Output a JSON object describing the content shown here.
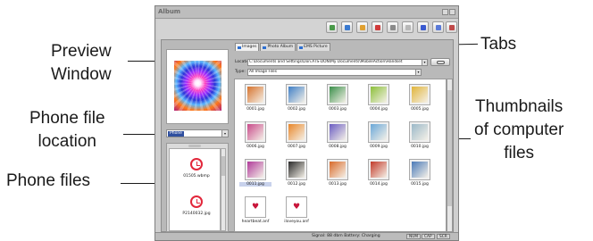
{
  "window": {
    "title": "Album"
  },
  "toolbar": {
    "icons": [
      "import-icon",
      "export-icon",
      "edit-icon",
      "delete-icon",
      "slideshow-icon",
      "rotate-left-icon",
      "rotate-right-icon",
      "info-icon",
      "print-icon"
    ]
  },
  "tabs": [
    {
      "label": "Images",
      "active": true
    },
    {
      "label": "Photo Album",
      "active": false
    },
    {
      "label": "EMS Picture",
      "active": false
    }
  ],
  "location": {
    "label": "Location:",
    "value": "C:\\Documents and Settings\\Don.ATS-DON\\My Documents\\MobileAction\\Handset"
  },
  "type": {
    "label": "Type:",
    "value": "All Image Files"
  },
  "phone": {
    "selected": "Phone"
  },
  "phone_files": [
    "01505.wbmp",
    "P2140032.jpg"
  ],
  "thumbnails": [
    {
      "name": "0001.jpg",
      "color": "#d6732e"
    },
    {
      "name": "0002.jpg",
      "color": "#3f7fc6"
    },
    {
      "name": "0003.jpg",
      "color": "#3a8f4a"
    },
    {
      "name": "0004.jpg",
      "color": "#8bbf3a"
    },
    {
      "name": "0005.jpg",
      "color": "#e0b43a"
    },
    {
      "name": "0006.jpg",
      "color": "#c84a8a"
    },
    {
      "name": "0007.jpg",
      "color": "#e8862a"
    },
    {
      "name": "0008.jpg",
      "color": "#6a5cc2"
    },
    {
      "name": "0009.jpg",
      "color": "#6aa8d8"
    },
    {
      "name": "0010.jpg",
      "color": "#9ab8c8"
    },
    {
      "name": "0011.jpg",
      "color": "#b03a9a"
    },
    {
      "name": "0012.jpg",
      "color": "#2a2a2a"
    },
    {
      "name": "0013.jpg",
      "color": "#d86a2a"
    },
    {
      "name": "0014.jpg",
      "color": "#c23a2a"
    },
    {
      "name": "0015.jpg",
      "color": "#4a7ab8"
    },
    {
      "name": "heartbeat.anf",
      "color": "#ffffff"
    },
    {
      "name": "iloveyou.anf",
      "color": "#ffffff"
    }
  ],
  "status": {
    "signal": "Signal: 88 dbm Battery: Charging",
    "num": "NUM",
    "cap": "CAP",
    "scr": "SCR"
  },
  "annotations": {
    "preview_line1": "Preview",
    "preview_line2": "Window",
    "location_line1": "Phone file",
    "location_line2": "location",
    "files": "Phone  files",
    "tabs": "Tabs",
    "thumbs_line1": "Thumbnails",
    "thumbs_line2": "of computer",
    "thumbs_line3": "files"
  }
}
